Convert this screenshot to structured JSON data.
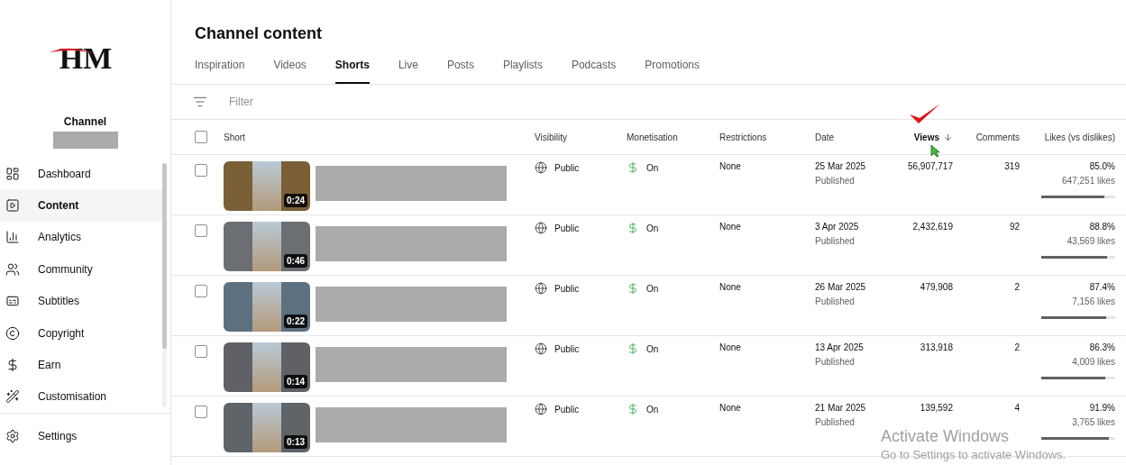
{
  "sidebar": {
    "logo": {
      "text": "HM"
    },
    "channel_label": "Channel",
    "items": [
      {
        "label": "Dashboard",
        "selected": false
      },
      {
        "label": "Content",
        "selected": true
      },
      {
        "label": "Analytics",
        "selected": false
      },
      {
        "label": "Community",
        "selected": false
      },
      {
        "label": "Subtitles",
        "selected": false
      },
      {
        "label": "Copyright",
        "selected": false
      },
      {
        "label": "Earn",
        "selected": false
      },
      {
        "label": "Customisation",
        "selected": false
      }
    ],
    "footer_items": [
      {
        "label": "Settings",
        "selected": false
      }
    ]
  },
  "page": {
    "title": "Channel content"
  },
  "tabs": [
    {
      "label": "Inspiration",
      "selected": false
    },
    {
      "label": "Videos",
      "selected": false
    },
    {
      "label": "Shorts",
      "selected": true
    },
    {
      "label": "Live",
      "selected": false
    },
    {
      "label": "Posts",
      "selected": false
    },
    {
      "label": "Playlists",
      "selected": false
    },
    {
      "label": "Podcasts",
      "selected": false
    },
    {
      "label": "Promotions",
      "selected": false
    }
  ],
  "filter": {
    "placeholder": "Filter"
  },
  "table": {
    "all_checked": false,
    "columns": [
      {
        "label": "Short",
        "sorted": false
      },
      {
        "label": "Visibility",
        "sorted": false
      },
      {
        "label": "Monetisation",
        "sorted": false
      },
      {
        "label": "Restrictions",
        "sorted": false
      },
      {
        "label": "Date",
        "sorted": false
      },
      {
        "label": "Views",
        "sorted": true
      },
      {
        "label": "Comments",
        "sorted": false
      },
      {
        "label": "Likes (vs dislikes)",
        "sorted": false
      }
    ],
    "rows": [
      {
        "checked": false,
        "duration": "0:24",
        "visibility": "Public",
        "monetisation": "On",
        "restrictions": "None",
        "date": "25 Mar 2025",
        "date_status": "Published",
        "views": "56,907,717",
        "comments": "319",
        "likes_percent": "85.0%",
        "likes_count": "647,251 likes",
        "level": 0.85
      },
      {
        "checked": false,
        "duration": "0:46",
        "visibility": "Public",
        "monetisation": "On",
        "restrictions": "None",
        "date": "3 Apr 2025",
        "date_status": "Published",
        "views": "2,432,619",
        "comments": "92",
        "likes_percent": "88.8%",
        "likes_count": "43,569 likes",
        "level": 0.888
      },
      {
        "checked": false,
        "duration": "0:22",
        "visibility": "Public",
        "monetisation": "On",
        "restrictions": "None",
        "date": "26 Mar 2025",
        "date_status": "Published",
        "views": "479,908",
        "comments": "2",
        "likes_percent": "87.4%",
        "likes_count": "7,156 likes",
        "level": 0.874
      },
      {
        "checked": false,
        "duration": "0:14",
        "visibility": "Public",
        "monetisation": "On",
        "restrictions": "None",
        "date": "13 Apr 2025",
        "date_status": "Published",
        "views": "313,918",
        "comments": "2",
        "likes_percent": "86.3%",
        "likes_count": "4,009 likes",
        "level": 0.863
      },
      {
        "checked": false,
        "duration": "0:13",
        "visibility": "Public",
        "monetisation": "On",
        "restrictions": "None",
        "date": "21 Mar 2025",
        "date_status": "Published",
        "views": "139,592",
        "comments": "4",
        "likes_percent": "91.9%",
        "likes_count": "3,765 likes",
        "level": 0.919
      }
    ]
  },
  "os_notice": {
    "title": "Activate Windows",
    "subtitle": "Go to Settings to activate Windows."
  }
}
